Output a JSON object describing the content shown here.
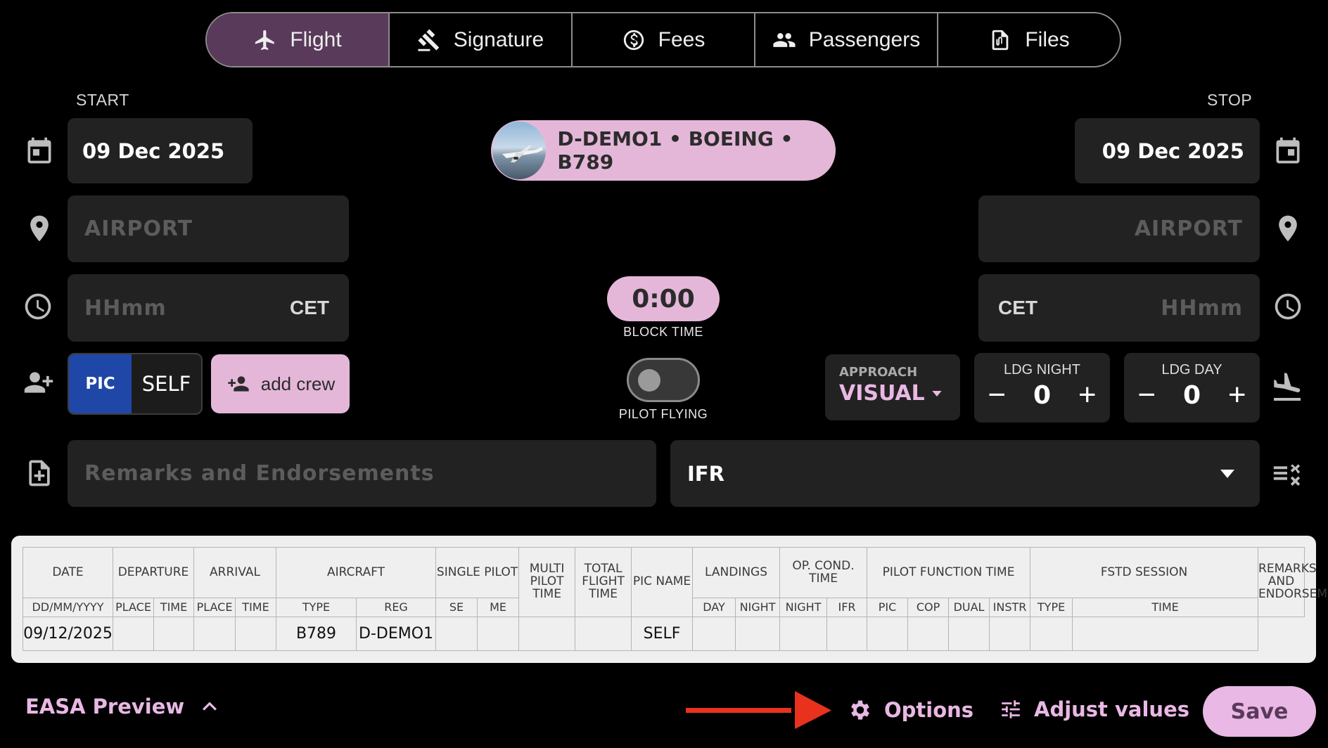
{
  "tabs": [
    {
      "label": "Flight",
      "icon": "airplane-icon",
      "active": true
    },
    {
      "label": "Signature",
      "icon": "gavel-icon"
    },
    {
      "label": "Fees",
      "icon": "dollar-icon"
    },
    {
      "label": "Passengers",
      "icon": "people-icon"
    },
    {
      "label": "Files",
      "icon": "paperclip-file-icon"
    }
  ],
  "start": {
    "label": "START",
    "date": "09 Dec 2025",
    "airport_placeholder": "AIRPORT",
    "time_placeholder": "HHmm",
    "tz": "CET"
  },
  "stop": {
    "label": "STOP",
    "date": "09 Dec 2025",
    "airport_placeholder": "AIRPORT",
    "time_placeholder": "HHmm",
    "tz": "CET"
  },
  "aircraft": {
    "text": "D-DEMO1 • BOEING • B789"
  },
  "block": {
    "time": "0:00",
    "label": "BLOCK TIME"
  },
  "pilot_flying": {
    "label": "PILOT FLYING",
    "on": false
  },
  "crew": {
    "role": "PIC",
    "name": "SELF",
    "add_label": "add crew"
  },
  "approach": {
    "label": "APPROACH",
    "value": "VISUAL"
  },
  "ldg_night": {
    "label": "LDG NIGHT",
    "value": "0",
    "minus": "−",
    "plus": "+"
  },
  "ldg_day": {
    "label": "LDG DAY",
    "value": "0",
    "minus": "−",
    "plus": "+"
  },
  "remarks": {
    "placeholder": "Remarks and Endorsements"
  },
  "rules": {
    "value": "IFR"
  },
  "log": {
    "h": {
      "date": "DATE",
      "departure": "DEPARTURE",
      "arrival": "ARRIVAL",
      "aircraft": "AIRCRAFT",
      "single_pilot": "SINGLE PILOT",
      "multi_pilot": "MULTI PILOT TIME",
      "total": "TOTAL FLIGHT TIME",
      "pic_name": "PIC NAME",
      "landings": "LANDINGS",
      "op_cond": "OP. COND. TIME",
      "pilot_fn": "PILOT FUNCTION TIME",
      "fstd": "FSTD SESSION",
      "remarks": "REMARKS AND ENDORSEMENTS"
    },
    "s": {
      "date": "DD/MM/YYYY",
      "place": "PLACE",
      "time": "TIME",
      "type": "TYPE",
      "reg": "REG",
      "se": "SE",
      "me": "ME",
      "day": "DAY",
      "night": "NIGHT",
      "ifr": "IFR",
      "pic": "PIC",
      "cop": "COP",
      "dual": "DUAL",
      "instr": "INSTR"
    },
    "row": {
      "date": "09/12/2025",
      "type": "B789",
      "reg": "D-DEMO1",
      "pic_name": "SELF"
    }
  },
  "bottom": {
    "preview": "EASA Preview",
    "options": "Options",
    "adjust": "Adjust values",
    "save": "Save"
  },
  "colors": {
    "accent": "#e4b7d9",
    "pic_blue": "#1f47a8",
    "arrow": "#e8321e"
  }
}
